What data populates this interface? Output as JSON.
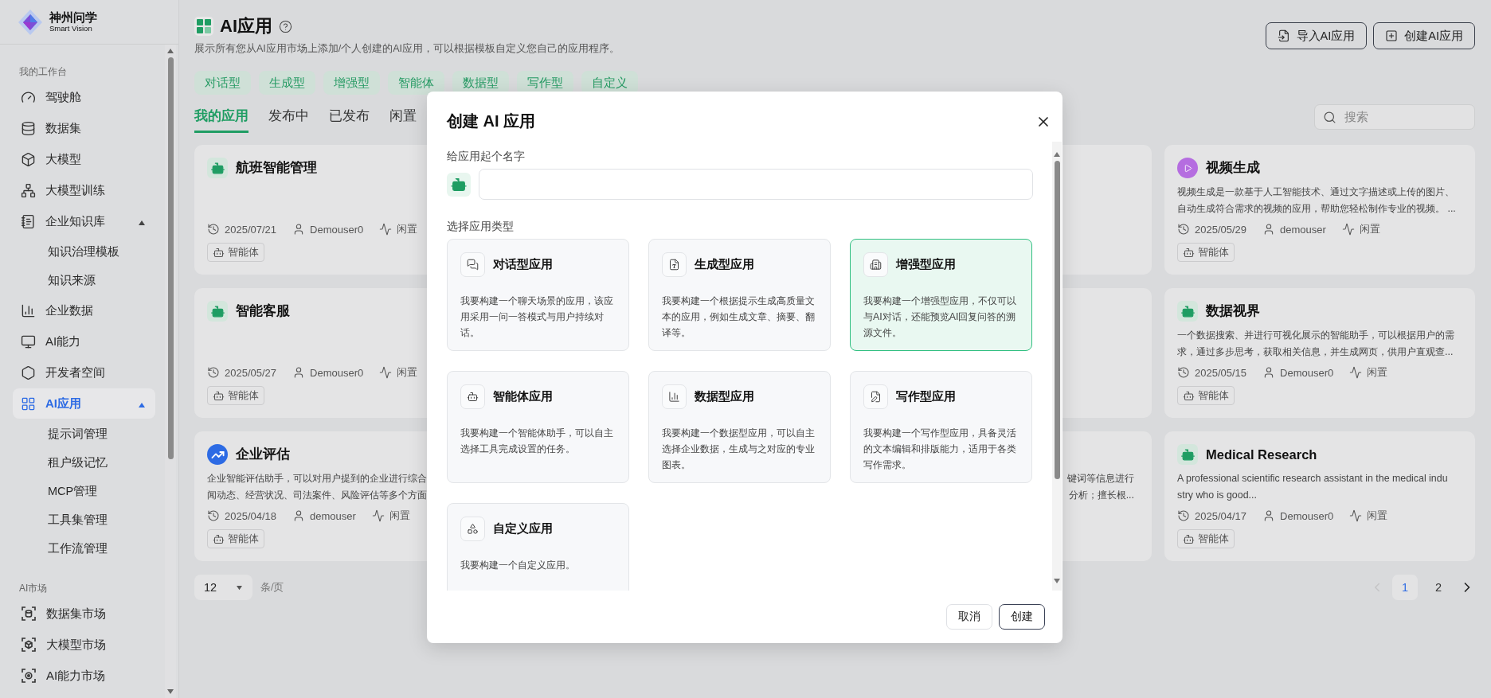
{
  "sidebar": {
    "logo": {
      "title": "神州问学",
      "subtitle": "Smart Vision"
    },
    "sections": [
      {
        "label": "我的工作台",
        "items": [
          {
            "label": "驾驶舱",
            "selected": false
          },
          {
            "label": "数据集",
            "selected": false
          },
          {
            "label": "大模型",
            "selected": false
          },
          {
            "label": "大模型训练",
            "selected": false
          },
          {
            "label": "企业知识库",
            "selected": false,
            "expanded": true,
            "children": [
              {
                "label": "知识治理模板",
                "selected": false
              },
              {
                "label": "知识来源",
                "selected": false
              }
            ]
          },
          {
            "label": "企业数据",
            "selected": false
          },
          {
            "label": "AI能力",
            "selected": false
          },
          {
            "label": "开发者空间",
            "selected": false
          },
          {
            "label": "AI应用",
            "selected": true,
            "expanded": true,
            "children": [
              {
                "label": "提示词管理",
                "selected": false
              },
              {
                "label": "租户级记忆",
                "selected": false
              },
              {
                "label": "MCP管理",
                "selected": false
              },
              {
                "label": "工具集管理",
                "selected": false
              },
              {
                "label": "工作流管理",
                "selected": false
              }
            ]
          }
        ]
      },
      {
        "label": "AI市场",
        "items": [
          {
            "label": "数据集市场",
            "selected": false
          },
          {
            "label": "大模型市场",
            "selected": false
          },
          {
            "label": "AI能力市场",
            "selected": false
          }
        ]
      }
    ]
  },
  "header": {
    "title": "AI应用",
    "description": "展示所有您从AI应用市场上添加/个人创建的AI应用，可以根据模板自定义您自己的应用程序。",
    "actions": [
      "导入AI应用",
      "创建AI应用"
    ]
  },
  "categories": [
    "对话型",
    "生成型",
    "增强型",
    "智能体",
    "数据型",
    "写作型",
    "自定义"
  ],
  "tabs": [
    {
      "label": "我的应用",
      "selected": true
    },
    {
      "label": "发布中",
      "selected": false
    },
    {
      "label": "已发布",
      "selected": false
    },
    {
      "label": "闲置",
      "selected": false
    }
  ],
  "search": {
    "placeholder": "搜索"
  },
  "cards": [
    {
      "kind": "robot",
      "title": "航班智能管理",
      "date": "2025/07/21",
      "user": "Demouser0",
      "status": "闲置",
      "tag": "智能体"
    },
    {
      "kind": "blank"
    },
    {
      "kind": "video",
      "title": "视频生成",
      "description_lines": [
        "视频生成是一款基于人工智能技术、通过文字描述或上传的图片、",
        "自动生成符合需求的视频的应用，帮助您轻松制作专业的视频。 ..."
      ],
      "date": "2025/05/29",
      "user": "demouser",
      "status": "闲置",
      "tag": "智能体"
    },
    {
      "kind": "robot",
      "title": "智能客服",
      "date": "2025/05/27",
      "user": "Demouser0",
      "status": "闲置",
      "tag": "智能体"
    },
    {
      "kind": "blank"
    },
    {
      "kind": "robot",
      "title": "数据视界",
      "description_lines": [
        "一个数据搜索、并进行可视化展示的智能助手，可以根据用户的需",
        "求，通过多步思考，获取相关信息，并生成网页，供用户直观查..."
      ],
      "date": "2025/05/15",
      "user": "Demouser0",
      "status": "闲置",
      "tag": "智能体"
    },
    {
      "kind": "chart",
      "title": "企业评估",
      "description_lines": [
        "企业智能评估助手，可以对用户提到的企业进行综合",
        "闻动态、经营状况、司法案件、风险评估等多个方面"
      ],
      "date": "2025/04/18",
      "user": "demouser",
      "status": "闲置",
      "tag": "智能体"
    },
    {
      "kind": "fragment",
      "description_lines": [
        "键词等信息进行",
        "分析；擅长根..."
      ]
    },
    {
      "kind": "robot",
      "title": "Medical Research",
      "description_lines": [
        "A professional scientific research assistant in the medical indu",
        "stry who is good..."
      ],
      "date": "2025/04/17",
      "user": "Demouser0",
      "status": "闲置",
      "tag": "智能体"
    }
  ],
  "pagination": {
    "page_size": "12",
    "page_size_unit": "条/页",
    "pages": [
      {
        "label": "1",
        "selected": true
      },
      {
        "label": "2",
        "selected": false
      }
    ]
  },
  "dialog": {
    "title": "创建 AI 应用",
    "name_label": "给应用起个名字",
    "type_label": "选择应用类型",
    "types": [
      {
        "title": "对话型应用",
        "description": "我要构建一个聊天场景的应用，该应用采用一问一答模式与用户持续对话。",
        "selected": false
      },
      {
        "title": "生成型应用",
        "description": "我要构建一个根据提示生成高质量文本的应用，例如生成文章、摘要、翻译等。",
        "selected": false
      },
      {
        "title": "增强型应用",
        "description": "我要构建一个增强型应用，不仅可以与AI对话，还能预览AI回复问答的溯源文件。",
        "selected": true
      },
      {
        "title": "智能体应用",
        "description": "我要构建一个智能体助手，可以自主选择工具完成设置的任务。",
        "selected": false
      },
      {
        "title": "数据型应用",
        "description": "我要构建一个数据型应用，可以自主选择企业数据，生成与之对应的专业图表。",
        "selected": false
      },
      {
        "title": "写作型应用",
        "description": "我要构建一个写作型应用，具备灵活的文本编辑和排版能力，适用于各类写作需求。",
        "selected": false
      },
      {
        "title": "自定义应用",
        "description": "我要构建一个自定义应用。",
        "selected": false
      }
    ],
    "buttons": [
      "取消",
      "创建"
    ]
  }
}
